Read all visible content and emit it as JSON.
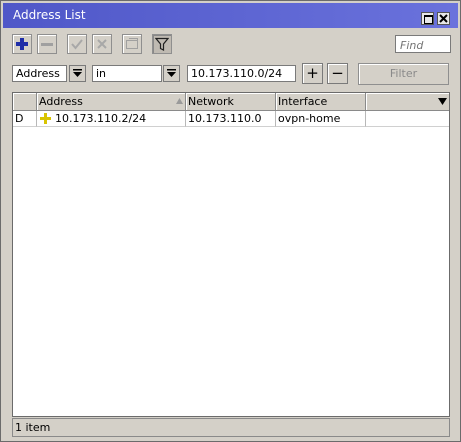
{
  "window": {
    "title": "Address List"
  },
  "toolbar": {
    "find_placeholder": "Find"
  },
  "filter": {
    "field": "Address",
    "operator": "in",
    "value": "10.173.110.0/24",
    "add_label": "+",
    "remove_label": "−",
    "apply_label": "Filter"
  },
  "table": {
    "columns": [
      "",
      "Address",
      "Network",
      "Interface",
      ""
    ],
    "rows": [
      {
        "flag": "D",
        "address": "10.173.110.2/24",
        "network": "10.173.110.0",
        "interface": "ovpn-home"
      }
    ]
  },
  "status": {
    "text": "1 item"
  },
  "colors": {
    "titlebar": "#5a62d2",
    "add_icon": "#1f2ea8",
    "dynamic_icon": "#d8c400"
  }
}
